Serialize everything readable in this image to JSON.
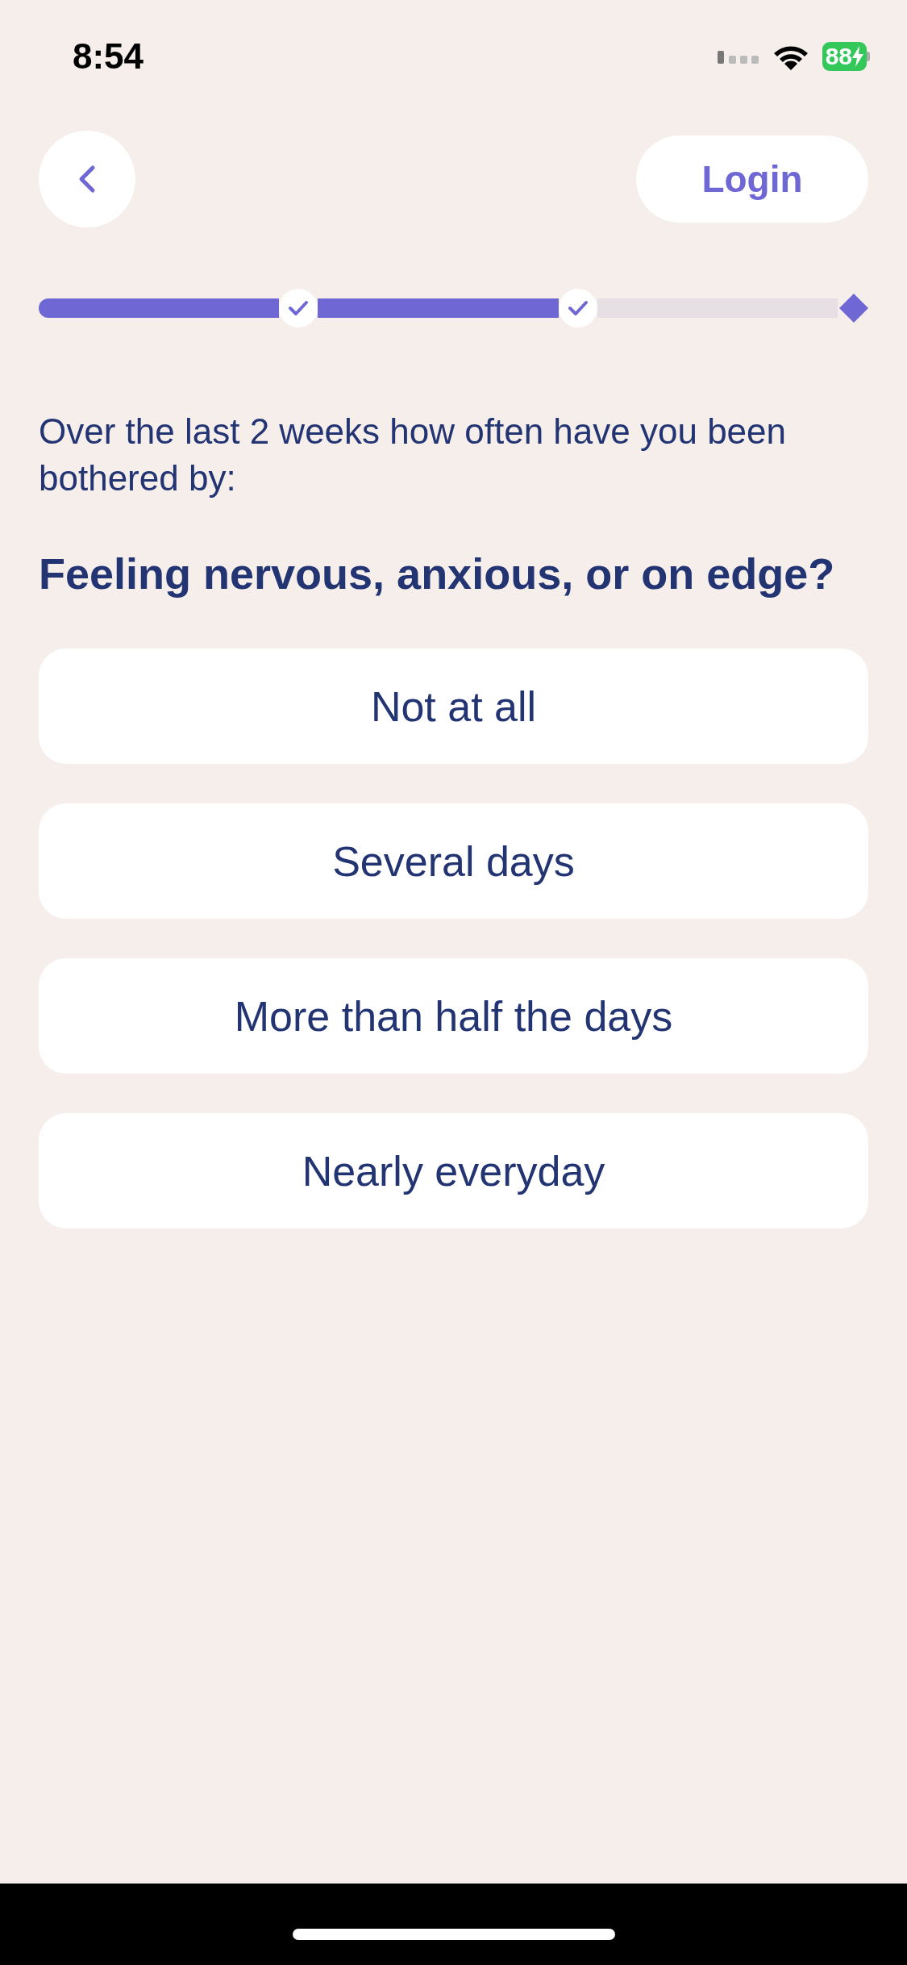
{
  "status_bar": {
    "time": "8:54",
    "battery": "88",
    "charging": true
  },
  "nav": {
    "login": "Login"
  },
  "progress": {
    "checkpoints": [
      {
        "done": true
      },
      {
        "done": true
      },
      {
        "done": false
      }
    ]
  },
  "intro": "Over the last 2 weeks how often have you been bothered by:",
  "question": "Feeling nervous, anxious, or on edge?",
  "options": [
    {
      "label": "Not at all",
      "selected": false
    },
    {
      "label": "Several days",
      "selected": false
    },
    {
      "label": "More than half the days",
      "selected": false
    },
    {
      "label": "Nearly everyday",
      "selected": false
    }
  ]
}
